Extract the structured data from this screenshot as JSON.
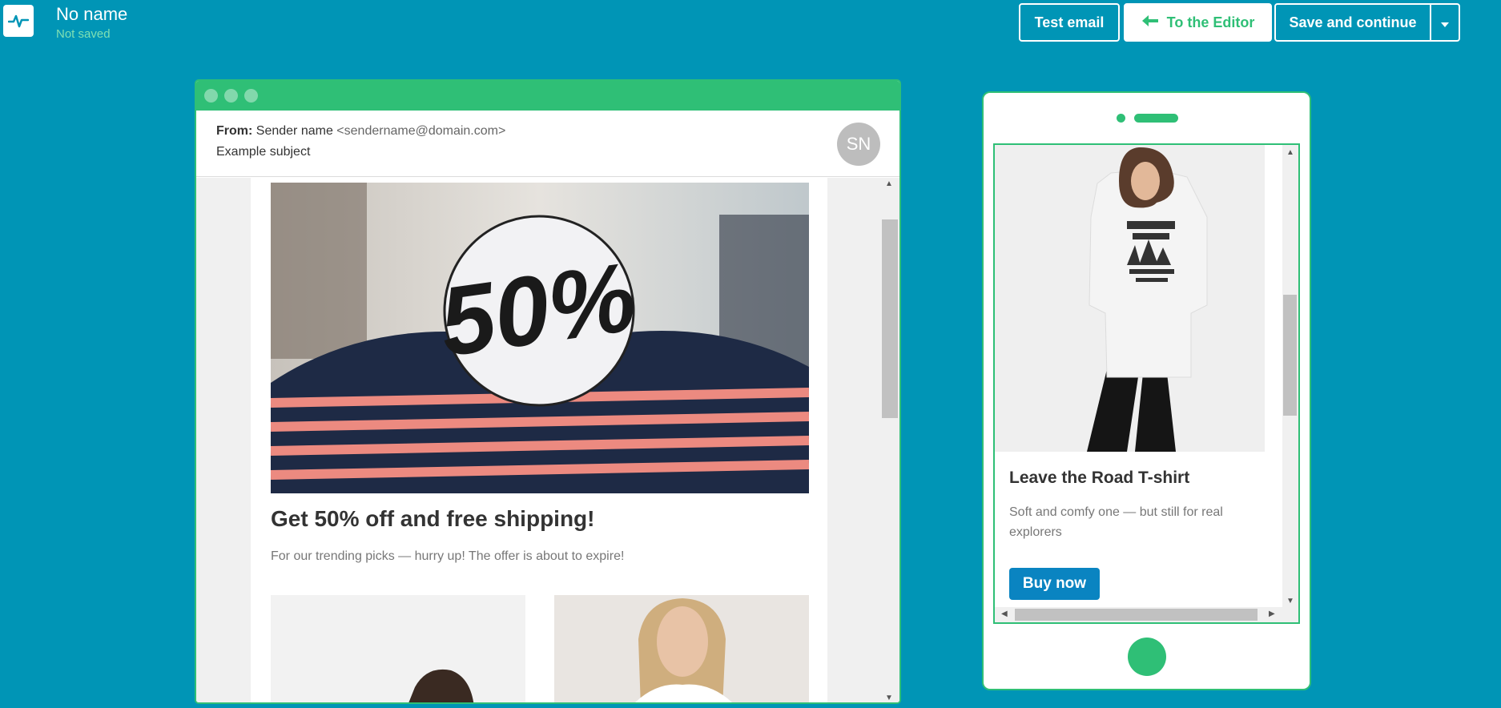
{
  "header": {
    "campaign_name": "No name",
    "save_status": "Not saved",
    "test_email_label": "Test email",
    "to_editor_label": "To the Editor",
    "save_continue_label": "Save and continue"
  },
  "desktop_preview": {
    "from_label": "From:",
    "sender_name": "Sender name",
    "sender_email": "<sendername@domain.com>",
    "subject": "Example subject",
    "avatar_initials": "SN",
    "hero_badge_text": "50%",
    "headline": "Get 50% off and free shipping!",
    "subtext": "For our trending picks — hurry up! The offer is about to expire!"
  },
  "mobile_preview": {
    "product_title": "Leave the Road T-shirt",
    "product_description": "Soft and comfy one — but still for real explorers",
    "buy_button_label": "Buy now"
  },
  "colors": {
    "background": "#0095b6",
    "accent_green": "#2fbf76",
    "buy_button": "#0a84c1"
  }
}
